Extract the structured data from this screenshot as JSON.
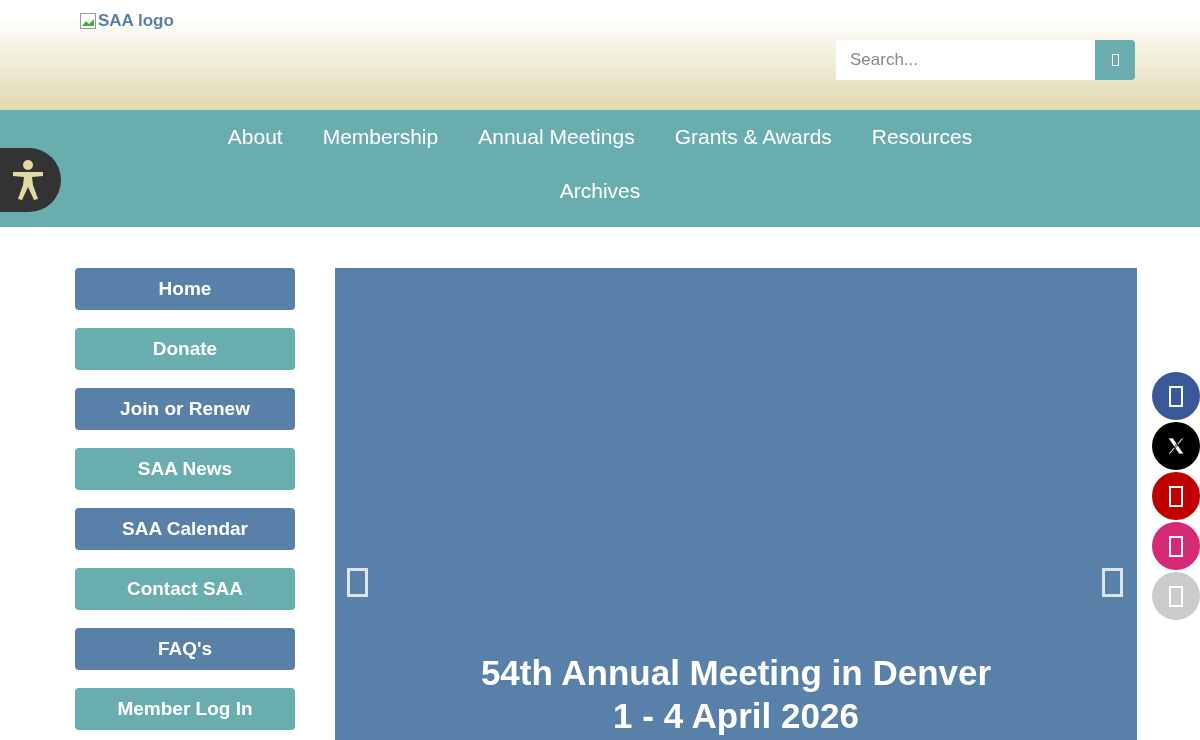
{
  "header": {
    "logo_alt": "SAA logo",
    "search": {
      "placeholder": "Search..."
    }
  },
  "nav": {
    "items": [
      {
        "label": "About"
      },
      {
        "label": "Membership"
      },
      {
        "label": "Annual Meetings"
      },
      {
        "label": "Grants & Awards"
      },
      {
        "label": "Resources"
      },
      {
        "label": "Archives"
      }
    ]
  },
  "sidebar": {
    "items": [
      {
        "label": "Home",
        "color": "#5880a8"
      },
      {
        "label": "Donate",
        "color": "#6aadae"
      },
      {
        "label": "Join or Renew",
        "color": "#5880a8"
      },
      {
        "label": "SAA News",
        "color": "#6aadae"
      },
      {
        "label": "SAA Calendar",
        "color": "#5880a8"
      },
      {
        "label": "Contact SAA",
        "color": "#6aadae"
      },
      {
        "label": "FAQ's",
        "color": "#5880a8"
      },
      {
        "label": "Member Log In",
        "color": "#6aadae"
      }
    ]
  },
  "slider": {
    "title": "54th Annual Meeting in Denver",
    "subtitle": "1 - 4 April 2026"
  },
  "social": [
    {
      "kind": "glyph",
      "color": "#3b5998"
    },
    {
      "kind": "x",
      "color": "#000000"
    },
    {
      "kind": "glyph",
      "color": "#c00000"
    },
    {
      "kind": "glyph",
      "color": "#d62976"
    },
    {
      "kind": "glyph",
      "color": "#cccccc"
    }
  ]
}
